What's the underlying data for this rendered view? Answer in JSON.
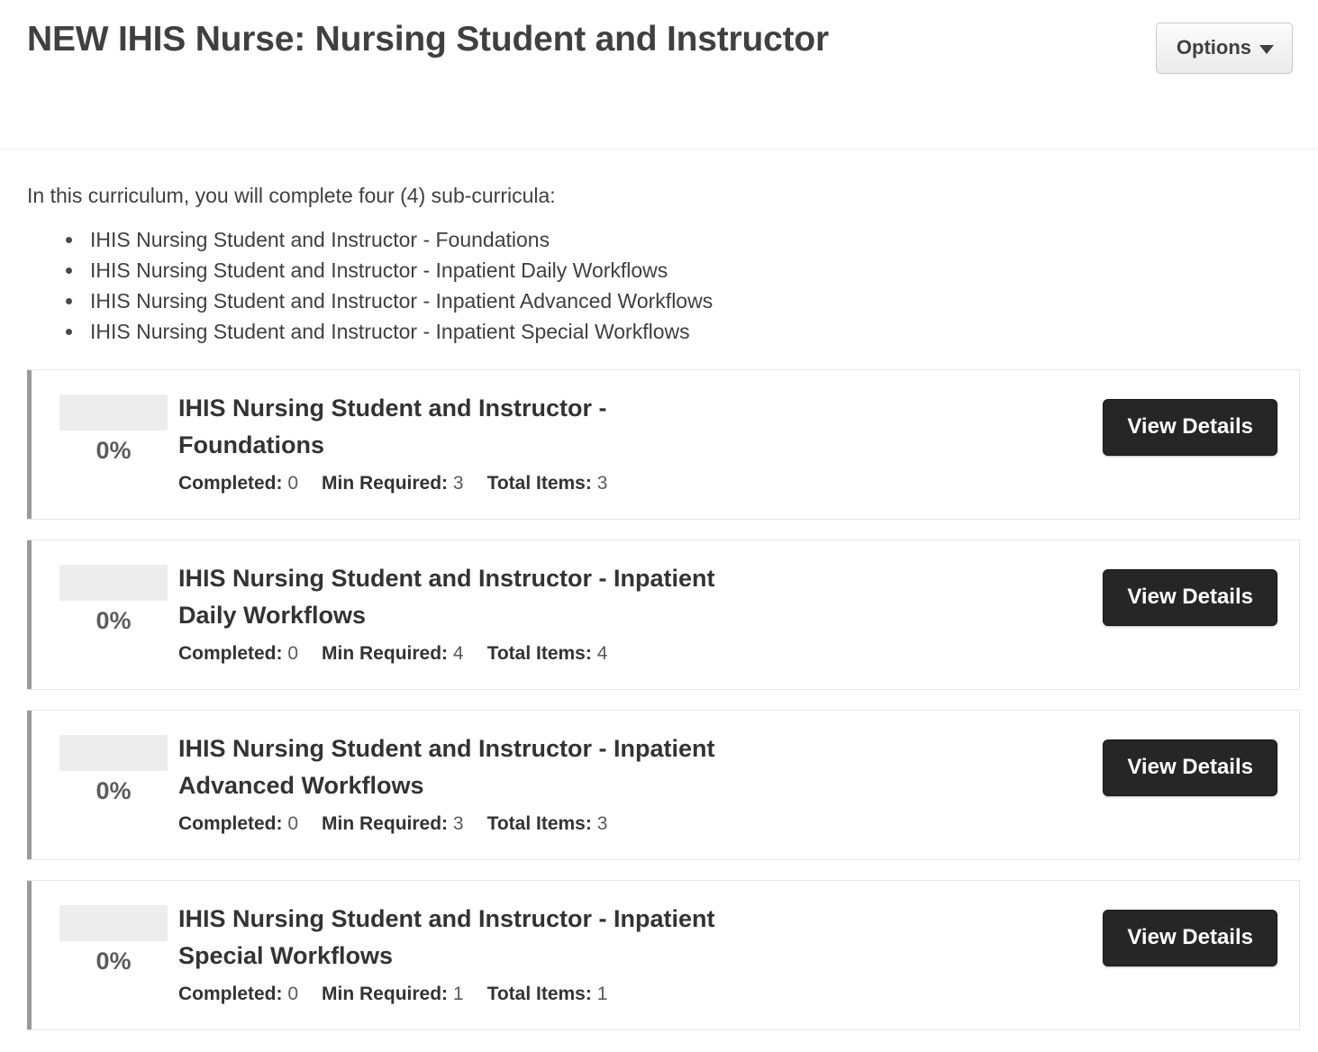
{
  "header": {
    "title": "NEW IHIS Nurse: Nursing Student and Instructor",
    "options_label": "Options"
  },
  "intro": {
    "lead": "In this curriculum, you will complete four (4) sub-curricula:",
    "items": [
      "IHIS Nursing Student and Instructor - Foundations",
      "IHIS Nursing Student and Instructor - Inpatient Daily Workflows",
      "IHIS Nursing Student and Instructor - Inpatient Advanced Workflows",
      "IHIS Nursing Student and Instructor - Inpatient Special Workflows"
    ]
  },
  "labels": {
    "completed": "Completed:",
    "min_required": "Min Required:",
    "total_items": "Total Items:",
    "view_details": "View Details"
  },
  "colors": {
    "accent_bar": "#9a9a9a",
    "button_dark": "#262626",
    "progress_track": "#ededed",
    "text_dark": "#333333"
  },
  "cards": [
    {
      "title": "IHIS Nursing Student and Instructor - Foundations",
      "percent": "0%",
      "percent_value": 0,
      "completed": "0",
      "min_required": "3",
      "total_items": "3",
      "action_label": "View Details"
    },
    {
      "title": "IHIS Nursing Student and Instructor - Inpatient Daily Workflows",
      "percent": "0%",
      "percent_value": 0,
      "completed": "0",
      "min_required": "4",
      "total_items": "4",
      "action_label": "View Details"
    },
    {
      "title": "IHIS Nursing Student and Instructor - Inpatient Advanced Workflows",
      "percent": "0%",
      "percent_value": 0,
      "completed": "0",
      "min_required": "3",
      "total_items": "3",
      "action_label": "View Details"
    },
    {
      "title": "IHIS Nursing Student and Instructor - Inpatient Special Workflows",
      "percent": "0%",
      "percent_value": 0,
      "completed": "0",
      "min_required": "1",
      "total_items": "1",
      "action_label": "View Details"
    }
  ]
}
